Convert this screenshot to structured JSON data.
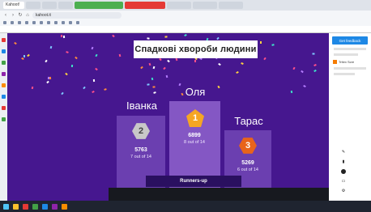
{
  "browser": {
    "tabs": [
      {
        "label": "Kahoot!",
        "style": "active"
      },
      {
        "label": "",
        "style": "plain"
      },
      {
        "label": "",
        "style": "plain"
      },
      {
        "label": "",
        "style": "plain"
      },
      {
        "label": "",
        "style": "green"
      },
      {
        "label": "",
        "style": "red"
      },
      {
        "label": "",
        "style": "plain"
      },
      {
        "label": "",
        "style": "plain"
      },
      {
        "label": "",
        "style": "plain"
      }
    ],
    "url": "kahoot.it",
    "bookmarks": [
      "",
      "",
      "",
      "",
      "",
      "",
      "",
      "",
      "",
      "",
      ""
    ],
    "site_notice": ""
  },
  "game": {
    "title": "Спадкові хвороби людини",
    "podium": {
      "first": {
        "name": "Оля",
        "rank": "1",
        "score": "6899",
        "out_of": "8 out of 14"
      },
      "second": {
        "name": "Іванка",
        "rank": "2",
        "score": "5763",
        "out_of": "7 out of 14"
      },
      "third": {
        "name": "Тарас",
        "rank": "3",
        "score": "5269",
        "out_of": "6 out of 14"
      }
    },
    "runners_up_label": "Runners-up",
    "table_headers": [
      "",
      "",
      "",
      "",
      ""
    ],
    "colors": {
      "background": "#46178f",
      "gold": "#f5a623",
      "silver": "#c8c8c8",
      "bronze": "#e8641b"
    }
  },
  "side_panel": {
    "header": "Get feedback",
    "item_label": "Tritex Scre"
  },
  "icons": [
    "back-icon",
    "forward-icon",
    "reload-icon",
    "home-icon",
    "pen-icon",
    "highlighter-icon",
    "record-icon",
    "eraser-icon",
    "settings-icon"
  ]
}
